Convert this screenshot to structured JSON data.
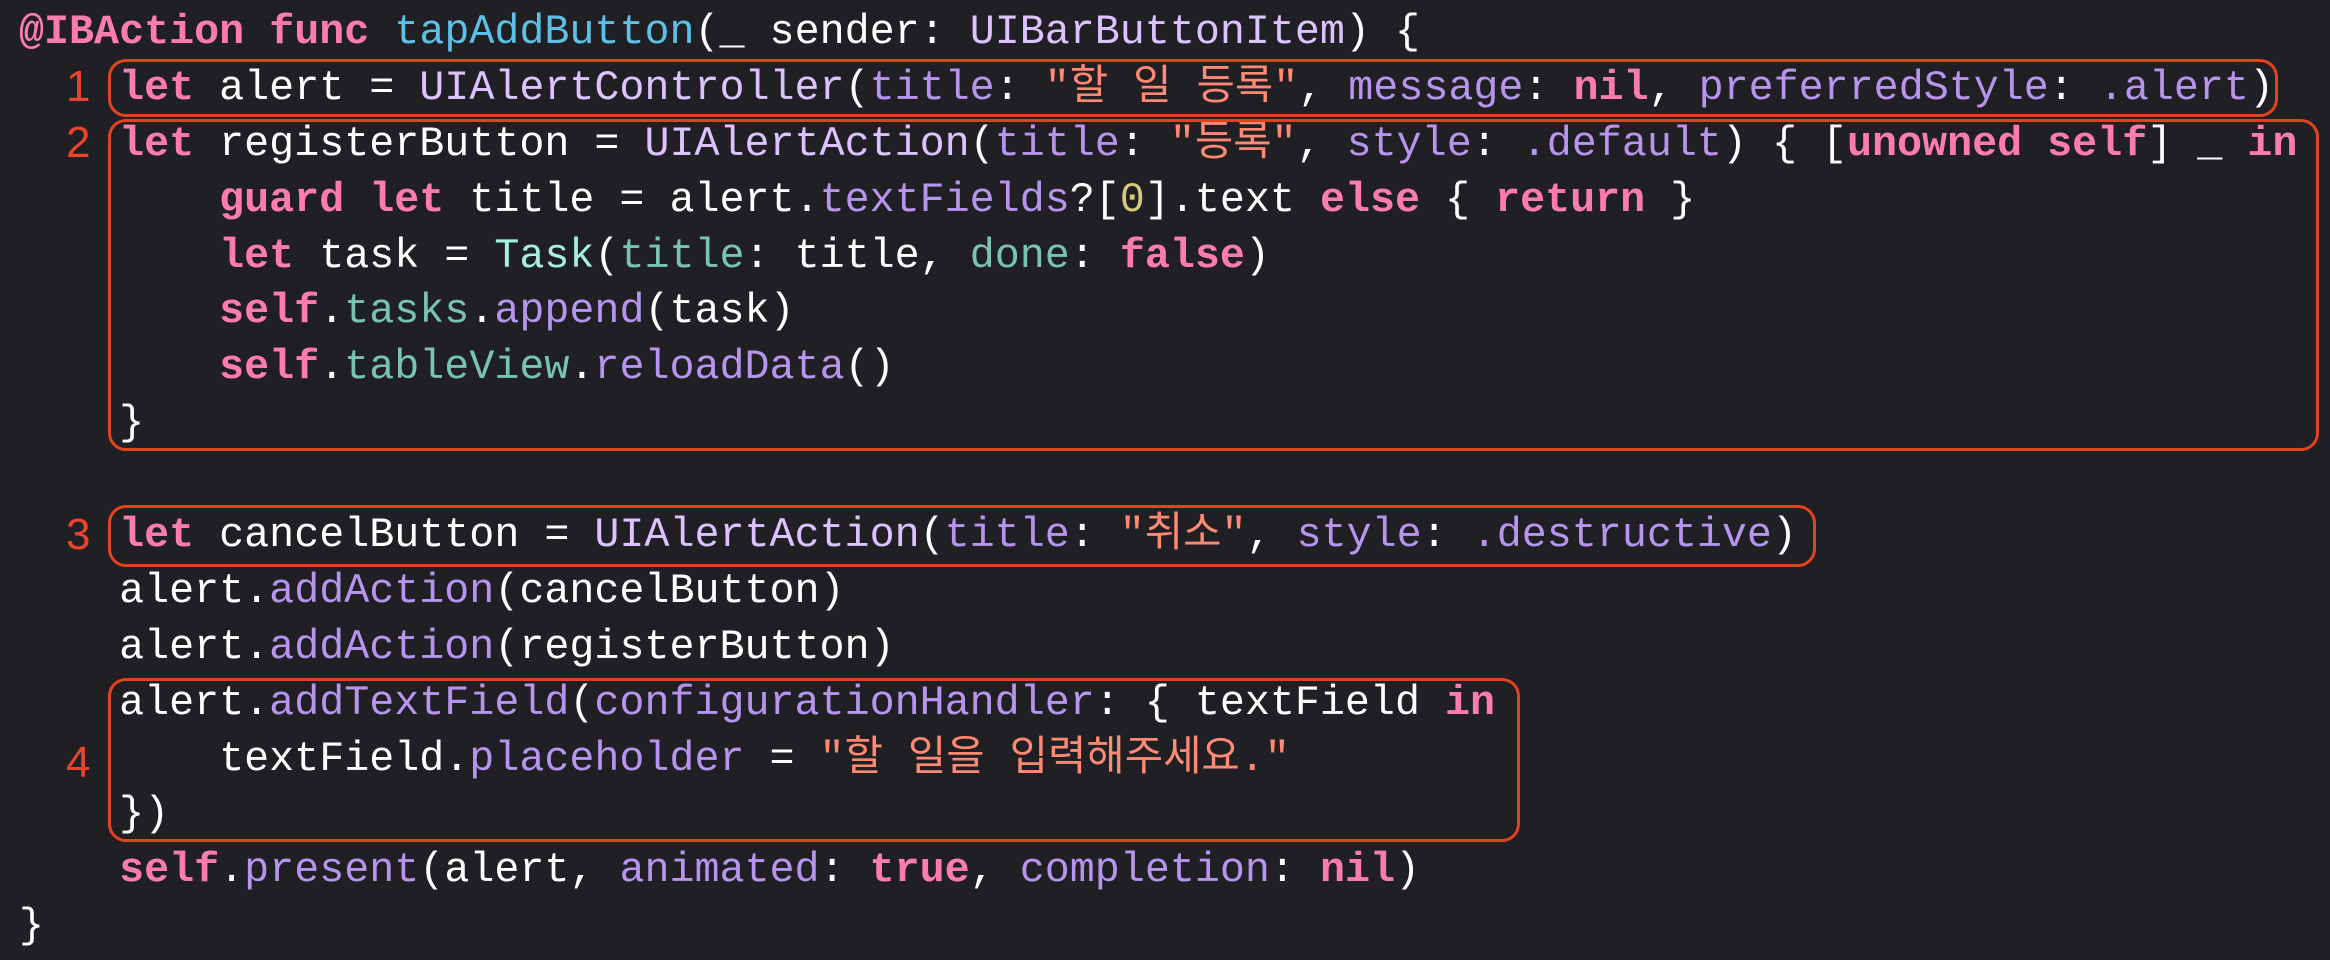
{
  "annotations": [
    "1",
    "2",
    "3",
    "4"
  ],
  "colors": {
    "background": "#1f1f24",
    "annotation": "#e2431f",
    "keyword": "#fc7cae",
    "string": "#ff8a74"
  },
  "code": {
    "lines": [
      {
        "indent": 0,
        "tokens": [
          {
            "c": "kw",
            "t": "@IBAction"
          },
          {
            "c": "plain",
            "t": " "
          },
          {
            "c": "kw",
            "t": "func"
          },
          {
            "c": "plain",
            "t": " "
          },
          {
            "c": "decl",
            "t": "tapAddButton"
          },
          {
            "c": "plain",
            "t": "(_ sender: "
          },
          {
            "c": "type",
            "t": "UIBarButtonItem"
          },
          {
            "c": "plain",
            "t": ") {"
          }
        ]
      },
      {
        "indent": 1,
        "tokens": [
          {
            "c": "kw",
            "t": "let"
          },
          {
            "c": "plain",
            "t": " alert = "
          },
          {
            "c": "type",
            "t": "UIAlertController"
          },
          {
            "c": "plain",
            "t": "("
          },
          {
            "c": "prop",
            "t": "title"
          },
          {
            "c": "plain",
            "t": ": "
          },
          {
            "c": "str",
            "t": "\"할 일 등록\""
          },
          {
            "c": "plain",
            "t": ", "
          },
          {
            "c": "prop",
            "t": "message"
          },
          {
            "c": "plain",
            "t": ": "
          },
          {
            "c": "kw",
            "t": "nil"
          },
          {
            "c": "plain",
            "t": ", "
          },
          {
            "c": "prop",
            "t": "preferredStyle"
          },
          {
            "c": "plain",
            "t": ": "
          },
          {
            "c": "prop",
            "t": ".alert"
          },
          {
            "c": "plain",
            "t": ")"
          }
        ]
      },
      {
        "indent": 1,
        "tokens": [
          {
            "c": "kw",
            "t": "let"
          },
          {
            "c": "plain",
            "t": " registerButton = "
          },
          {
            "c": "type",
            "t": "UIAlertAction"
          },
          {
            "c": "plain",
            "t": "("
          },
          {
            "c": "prop",
            "t": "title"
          },
          {
            "c": "plain",
            "t": ": "
          },
          {
            "c": "str",
            "t": "\"등록\""
          },
          {
            "c": "plain",
            "t": ", "
          },
          {
            "c": "prop",
            "t": "style"
          },
          {
            "c": "plain",
            "t": ": "
          },
          {
            "c": "prop",
            "t": ".default"
          },
          {
            "c": "plain",
            "t": ") { ["
          },
          {
            "c": "kw",
            "t": "unowned"
          },
          {
            "c": "plain",
            "t": " "
          },
          {
            "c": "kw",
            "t": "self"
          },
          {
            "c": "plain",
            "t": "] _ "
          },
          {
            "c": "kw",
            "t": "in"
          }
        ]
      },
      {
        "indent": 2,
        "tokens": [
          {
            "c": "kw",
            "t": "guard"
          },
          {
            "c": "plain",
            "t": " "
          },
          {
            "c": "kw",
            "t": "let"
          },
          {
            "c": "plain",
            "t": " title = alert."
          },
          {
            "c": "prop",
            "t": "textFields"
          },
          {
            "c": "plain",
            "t": "?["
          },
          {
            "c": "num",
            "t": "0"
          },
          {
            "c": "plain",
            "t": "].text "
          },
          {
            "c": "kw",
            "t": "else"
          },
          {
            "c": "plain",
            "t": " { "
          },
          {
            "c": "kw",
            "t": "return"
          },
          {
            "c": "plain",
            "t": " }"
          }
        ]
      },
      {
        "indent": 2,
        "tokens": [
          {
            "c": "kw",
            "t": "let"
          },
          {
            "c": "plain",
            "t": " task = "
          },
          {
            "c": "ptype",
            "t": "Task"
          },
          {
            "c": "plain",
            "t": "("
          },
          {
            "c": "pprop",
            "t": "title"
          },
          {
            "c": "plain",
            "t": ": title, "
          },
          {
            "c": "pprop",
            "t": "done"
          },
          {
            "c": "plain",
            "t": ": "
          },
          {
            "c": "kw",
            "t": "false"
          },
          {
            "c": "plain",
            "t": ")"
          }
        ]
      },
      {
        "indent": 2,
        "tokens": [
          {
            "c": "kw",
            "t": "self"
          },
          {
            "c": "plain",
            "t": "."
          },
          {
            "c": "pprop",
            "t": "tasks"
          },
          {
            "c": "plain",
            "t": "."
          },
          {
            "c": "prop",
            "t": "append"
          },
          {
            "c": "plain",
            "t": "(task)"
          }
        ]
      },
      {
        "indent": 2,
        "tokens": [
          {
            "c": "kw",
            "t": "self"
          },
          {
            "c": "plain",
            "t": "."
          },
          {
            "c": "pprop",
            "t": "tableView"
          },
          {
            "c": "plain",
            "t": "."
          },
          {
            "c": "prop",
            "t": "reloadData"
          },
          {
            "c": "plain",
            "t": "()"
          }
        ]
      },
      {
        "indent": 1,
        "tokens": [
          {
            "c": "plain",
            "t": "}"
          }
        ]
      },
      {
        "indent": 0,
        "tokens": []
      },
      {
        "indent": 1,
        "tokens": [
          {
            "c": "kw",
            "t": "let"
          },
          {
            "c": "plain",
            "t": " cancelButton = "
          },
          {
            "c": "type",
            "t": "UIAlertAction"
          },
          {
            "c": "plain",
            "t": "("
          },
          {
            "c": "prop",
            "t": "title"
          },
          {
            "c": "plain",
            "t": ": "
          },
          {
            "c": "str",
            "t": "\"취소\""
          },
          {
            "c": "plain",
            "t": ", "
          },
          {
            "c": "prop",
            "t": "style"
          },
          {
            "c": "plain",
            "t": ": "
          },
          {
            "c": "prop",
            "t": ".destructive"
          },
          {
            "c": "plain",
            "t": ")"
          }
        ]
      },
      {
        "indent": 1,
        "tokens": [
          {
            "c": "plain",
            "t": "alert."
          },
          {
            "c": "prop",
            "t": "addAction"
          },
          {
            "c": "plain",
            "t": "(cancelButton)"
          }
        ]
      },
      {
        "indent": 1,
        "tokens": [
          {
            "c": "plain",
            "t": "alert."
          },
          {
            "c": "prop",
            "t": "addAction"
          },
          {
            "c": "plain",
            "t": "(registerButton)"
          }
        ]
      },
      {
        "indent": 1,
        "tokens": [
          {
            "c": "plain",
            "t": "alert."
          },
          {
            "c": "prop",
            "t": "addTextField"
          },
          {
            "c": "plain",
            "t": "("
          },
          {
            "c": "prop",
            "t": "configurationHandler"
          },
          {
            "c": "plain",
            "t": ": { textField "
          },
          {
            "c": "kw",
            "t": "in"
          }
        ]
      },
      {
        "indent": 2,
        "tokens": [
          {
            "c": "plain",
            "t": "textField."
          },
          {
            "c": "prop",
            "t": "placeholder"
          },
          {
            "c": "plain",
            "t": " = "
          },
          {
            "c": "str",
            "t": "\"할 일을 입력해주세요.\""
          }
        ]
      },
      {
        "indent": 1,
        "tokens": [
          {
            "c": "plain",
            "t": "})"
          }
        ]
      },
      {
        "indent": 1,
        "tokens": [
          {
            "c": "kw",
            "t": "self"
          },
          {
            "c": "plain",
            "t": "."
          },
          {
            "c": "prop",
            "t": "present"
          },
          {
            "c": "plain",
            "t": "(alert, "
          },
          {
            "c": "prop",
            "t": "animated"
          },
          {
            "c": "plain",
            "t": ": "
          },
          {
            "c": "kw",
            "t": "true"
          },
          {
            "c": "plain",
            "t": ", "
          },
          {
            "c": "prop",
            "t": "completion"
          },
          {
            "c": "plain",
            "t": ": "
          },
          {
            "c": "kw",
            "t": "nil"
          },
          {
            "c": "plain",
            "t": ")"
          }
        ]
      },
      {
        "indent": 0,
        "tokens": [
          {
            "c": "plain",
            "t": "}"
          }
        ]
      }
    ]
  }
}
